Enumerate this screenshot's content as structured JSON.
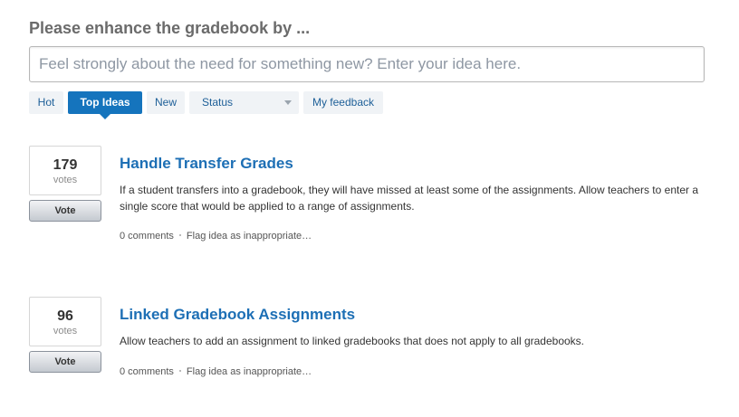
{
  "page": {
    "heading": "Please enhance the gradebook by ...",
    "idea_input_placeholder": "Feel strongly about the need for something new? Enter your idea here."
  },
  "tabs": {
    "hot": "Hot",
    "top_ideas": "Top Ideas",
    "new": "New",
    "status": "Status",
    "my_feedback": "My feedback",
    "active": "Top Ideas"
  },
  "ideas": [
    {
      "votes": "179",
      "votes_label": "votes",
      "vote_button": "Vote",
      "title": "Handle Transfer Grades",
      "body": "If a student transfers into a gradebook, they will have missed at least some of the assignments. Allow teachers to enter a single score that would be applied to a range of assignments.",
      "comments": "0 comments",
      "flag": "Flag idea as inappropriate…"
    },
    {
      "votes": "96",
      "votes_label": "votes",
      "vote_button": "Vote",
      "title": "Linked Gradebook Assignments",
      "body": "Allow teachers to add an assignment to linked gradebooks that does not apply to all gradebooks.",
      "comments": "0 comments",
      "flag": "Flag idea as inappropriate…"
    }
  ],
  "colors": {
    "accent": "#1574bd",
    "title_link": "#1d6fb5",
    "heading": "#6b6b6b"
  },
  "icons": {
    "status_dropdown": "chevron-down-icon",
    "meta_separator": "dot-separator-icon"
  }
}
